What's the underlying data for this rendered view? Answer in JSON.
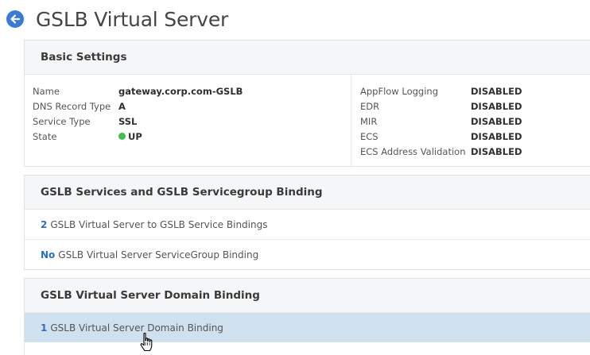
{
  "header": {
    "title": "GSLB Virtual Server",
    "back_icon": "arrow-left-icon",
    "accent_color": "#3b7bd4"
  },
  "basic_settings": {
    "title": "Basic Settings",
    "left": [
      {
        "label": "Name",
        "value": "gateway.corp.com-GSLB"
      },
      {
        "label": "DNS Record Type",
        "value": "A"
      },
      {
        "label": "Service Type",
        "value": "SSL"
      },
      {
        "label": "State",
        "value": "UP",
        "status_color": "#3fbf4f"
      }
    ],
    "right": [
      {
        "label": "AppFlow Logging",
        "value": "DISABLED"
      },
      {
        "label": "EDR",
        "value": "DISABLED"
      },
      {
        "label": "MIR",
        "value": "DISABLED"
      },
      {
        "label": "ECS",
        "value": "DISABLED"
      },
      {
        "label": "ECS Address Validation",
        "value": "DISABLED"
      }
    ]
  },
  "services_binding": {
    "title": "GSLB Services and GSLB Servicegroup Binding",
    "rows": [
      {
        "count": "2",
        "text": "GSLB Virtual Server to GSLB Service Bindings"
      },
      {
        "count": "No",
        "text": "GSLB Virtual Server ServiceGroup Binding"
      }
    ]
  },
  "domain_binding": {
    "title": "GSLB Virtual Server Domain Binding",
    "rows": [
      {
        "count": "1",
        "text": "GSLB Virtual Server Domain Binding"
      }
    ]
  },
  "colors": {
    "link": "#2c6fbf",
    "active_row": "#cfe0ef"
  }
}
